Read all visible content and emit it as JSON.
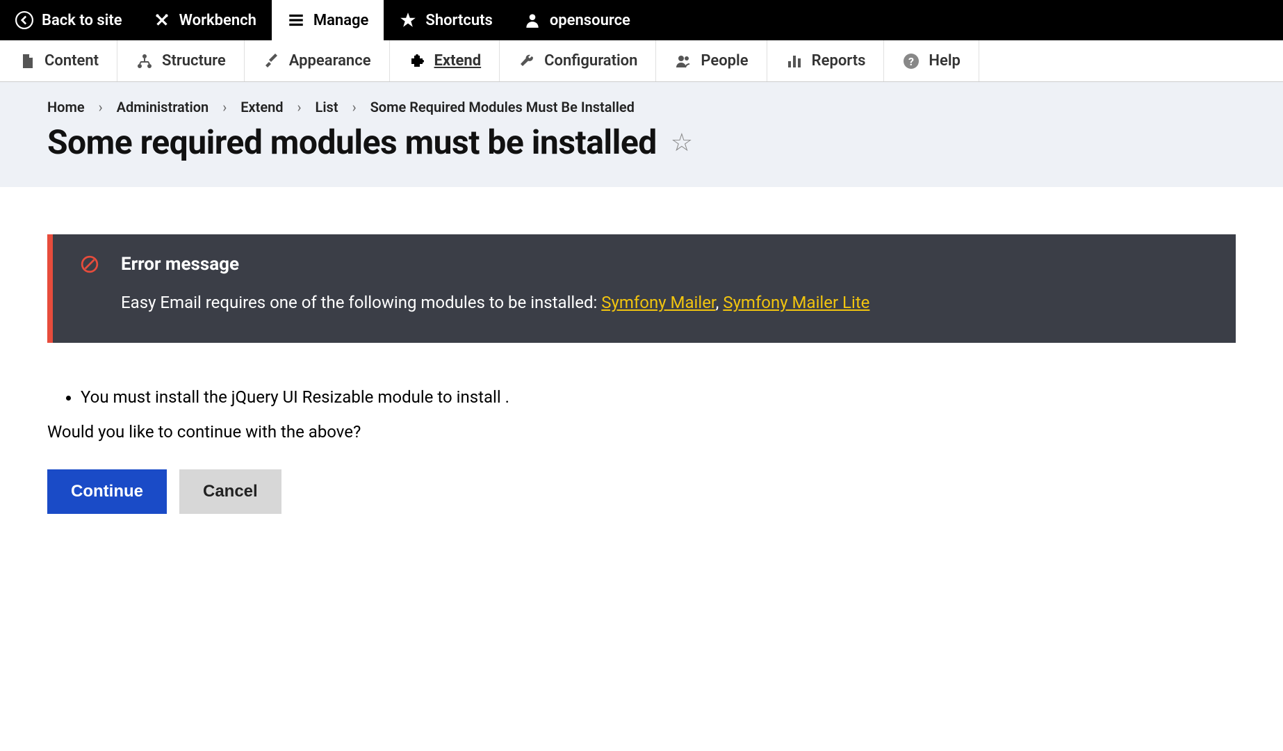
{
  "topbar": {
    "back": "Back to site",
    "workbench": "Workbench",
    "manage": "Manage",
    "shortcuts": "Shortcuts",
    "user": "opensource"
  },
  "subbar": {
    "content": "Content",
    "structure": "Structure",
    "appearance": "Appearance",
    "extend": "Extend",
    "configuration": "Configuration",
    "people": "People",
    "reports": "Reports",
    "help": "Help"
  },
  "breadcrumb": {
    "home": "Home",
    "administration": "Administration",
    "extend": "Extend",
    "list": "List",
    "current": "Some Required Modules Must Be Installed"
  },
  "page": {
    "title": "Some required modules must be installed"
  },
  "error": {
    "title": "Error message",
    "prefix": "Easy Email requires one of the following modules to be installed: ",
    "link1": "Symfony Mailer",
    "sep": ", ",
    "link2": "Symfony Mailer Lite"
  },
  "info": {
    "item1": "You must install the jQuery UI Resizable module to install .",
    "prompt": "Would you like to continue with the above?"
  },
  "buttons": {
    "continue": "Continue",
    "cancel": "Cancel"
  }
}
